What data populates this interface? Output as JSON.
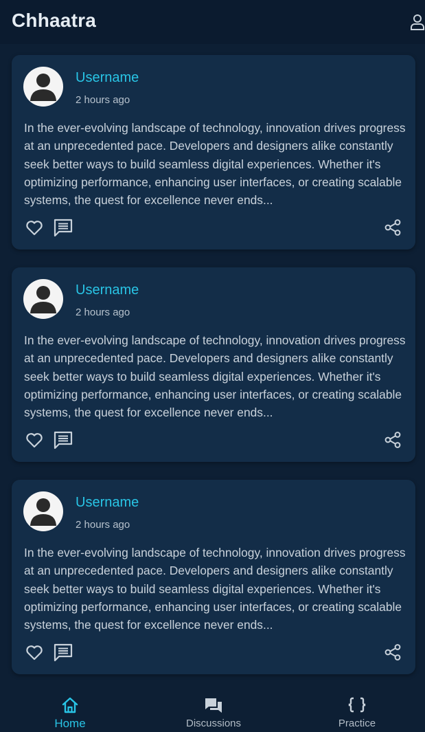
{
  "app": {
    "title": "Chhaatra"
  },
  "posts": [
    {
      "username": "Username",
      "time": "2 hours ago",
      "body": "In the ever-evolving landscape of technology, innovation drives progress at an unprecedented pace. Developers and designers alike constantly seek better ways to build seamless digital experiences. Whether it's optimizing performance, enhancing user interfaces, or creating scalable systems, the quest for excellence never ends..."
    },
    {
      "username": "Username",
      "time": "2 hours ago",
      "body": "In the ever-evolving landscape of technology, innovation drives progress at an unprecedented pace. Developers and designers alike constantly seek better ways to build seamless digital experiences. Whether it's optimizing performance, enhancing user interfaces, or creating scalable systems, the quest for excellence never ends..."
    },
    {
      "username": "Username",
      "time": "2 hours ago",
      "body": "In the ever-evolving landscape of technology, innovation drives progress at an unprecedented pace. Developers and designers alike constantly seek better ways to build seamless digital experiences. Whether it's optimizing performance, enhancing user interfaces, or creating scalable systems, the quest for excellence never ends..."
    }
  ],
  "nav": [
    {
      "label": "Home",
      "icon": "home-icon",
      "active": true
    },
    {
      "label": "Discussions",
      "icon": "discussions-icon",
      "active": false
    },
    {
      "label": "Practice",
      "icon": "code-braces-icon",
      "active": false
    }
  ],
  "colors": {
    "background": "#0d1f34",
    "card": "#132d48",
    "accent": "#29c5e6",
    "text": "#c9d2db",
    "muted": "#b7c2cd"
  }
}
